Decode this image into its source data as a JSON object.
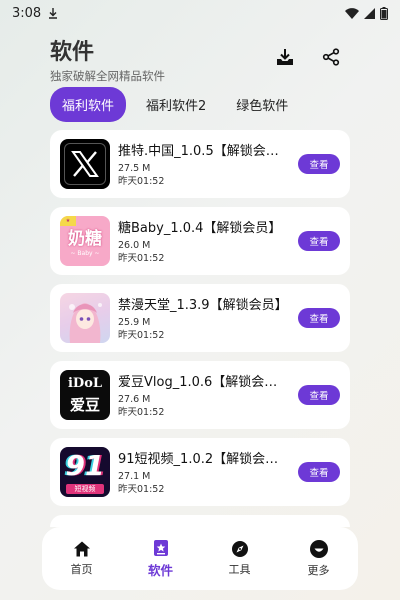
{
  "status_bar": {
    "time": "3:08"
  },
  "header": {
    "title": "软件",
    "subtitle": "独家破解全网精品软件"
  },
  "tabs": [
    {
      "label": "福利软件"
    },
    {
      "label": "福利软件2"
    },
    {
      "label": "绿色软件"
    }
  ],
  "apps": [
    {
      "name": "推特.中国_1.0.5【解锁会员】",
      "size": "27.5 M",
      "time": "昨天01:52",
      "button": "查看",
      "icon": "x-logo"
    },
    {
      "name": "糖Baby_1.0.4【解锁会员】",
      "size": "26.0 M",
      "time": "昨天01:52",
      "button": "查看",
      "icon": "tangbaby-logo",
      "icon_text": "奶糖",
      "icon_sub": "~ Baby ~"
    },
    {
      "name": "禁漫天堂_1.3.9【解锁会员】",
      "size": "25.9 M",
      "time": "昨天01:52",
      "button": "查看",
      "icon": "anime-logo"
    },
    {
      "name": "爱豆Vlog_1.0.6【解锁会员】",
      "size": "27.6 M",
      "time": "昨天01:52",
      "button": "查看",
      "icon": "idol-logo",
      "icon_text": "iDoL",
      "icon_sub": "爱豆"
    },
    {
      "name": "91短视频_1.0.2【解锁会员】",
      "size": "27.1 M",
      "time": "昨天01:52",
      "button": "查看",
      "icon": "91-logo",
      "icon_text": "91",
      "icon_sub": "短视频"
    }
  ],
  "bottom_nav": [
    {
      "label": "首页",
      "icon": "home-icon"
    },
    {
      "label": "软件",
      "icon": "apps-icon"
    },
    {
      "label": "工具",
      "icon": "compass-icon"
    },
    {
      "label": "更多",
      "icon": "smile-icon"
    }
  ],
  "colors": {
    "accent": "#6d39d6"
  }
}
